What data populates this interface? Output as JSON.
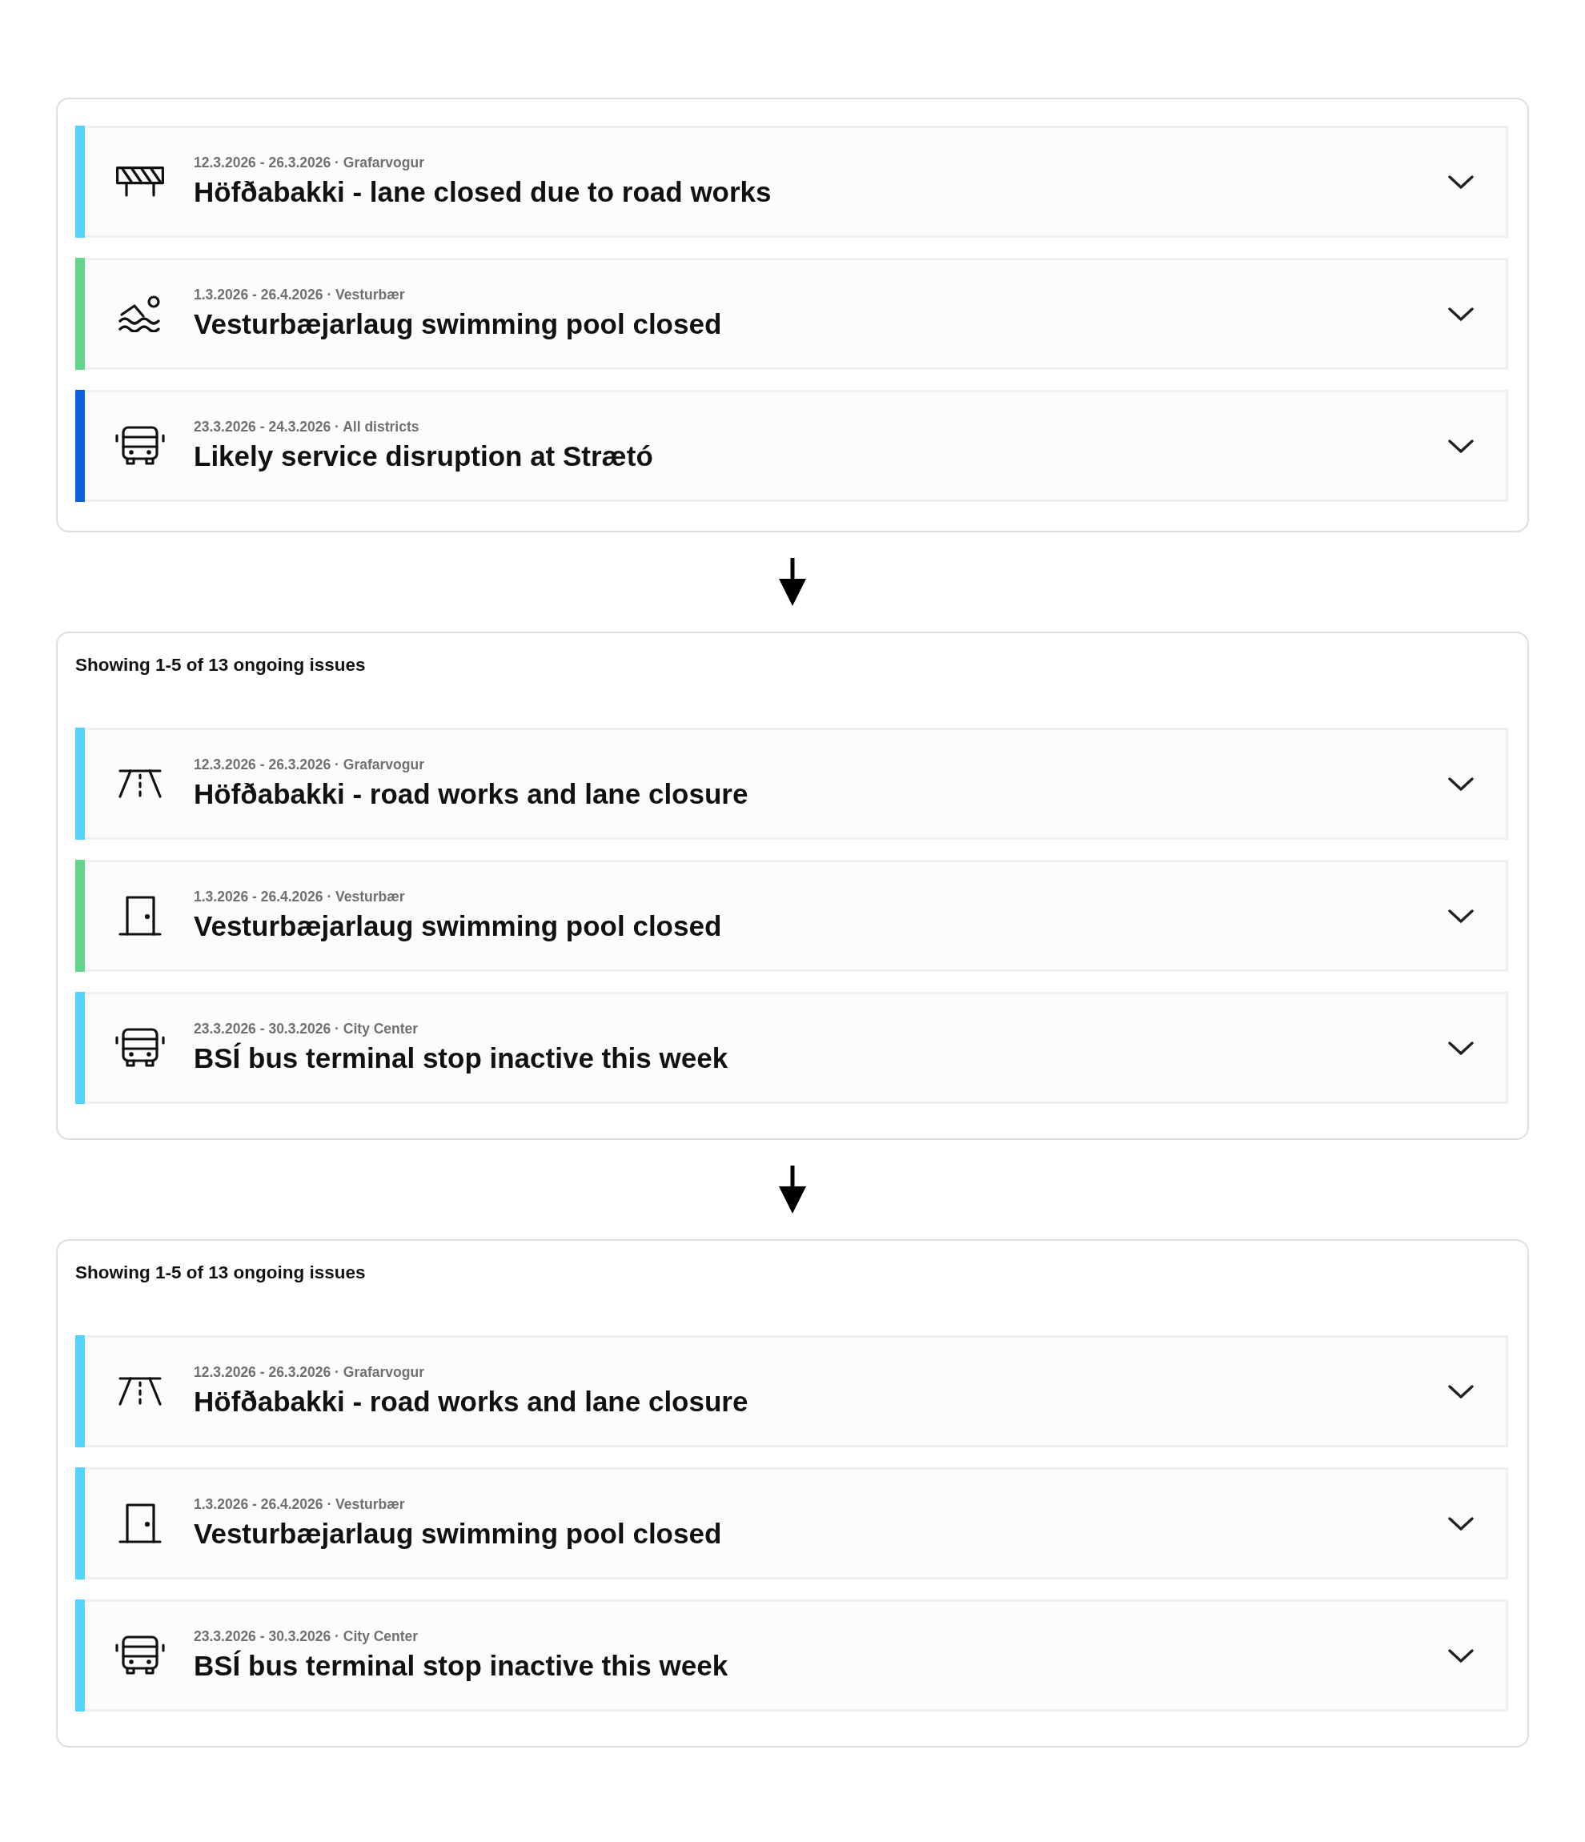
{
  "panels": [
    {
      "items": [
        {
          "kind": "barrier",
          "color": "#52d5fc",
          "meta": "12.3.2026 - 26.3.2026 · Grafarvogur",
          "title": "Höfðabakki - lane closed due to road works",
          "expanded": false
        },
        {
          "kind": "swimmer",
          "color": "#63d48c",
          "meta": "1.3.2026 - 26.4.2026 · Vesturbær",
          "title": "Vesturbæjarlaug swimming pool closed",
          "expanded": false
        },
        {
          "kind": "bus",
          "color": "#0b62de",
          "meta": "23.3.2026 - 24.3.2026 · All districts",
          "title": "Likely service disruption at Strætó",
          "expanded": false
        }
      ]
    },
    {
      "summary": "Showing 1-5 of 13 ongoing issues",
      "items": [
        {
          "kind": "road",
          "color": "#52d5fc",
          "meta": "12.3.2026 - 26.3.2026 · Grafarvogur",
          "title": "Höfðabakki - road works and lane closure",
          "expanded": false
        },
        {
          "kind": "door",
          "color": "#63d48c",
          "meta": "1.3.2026 - 26.4.2026 · Vesturbær",
          "title": "Vesturbæjarlaug swimming pool closed",
          "expanded": false
        },
        {
          "kind": "bus",
          "color": "#52d5fc",
          "meta": "23.3.2026 - 30.3.2026 · City Center",
          "title": "BSÍ bus terminal stop inactive this week",
          "expanded": false
        }
      ]
    },
    {
      "summary": "Showing 1-5 of 13 ongoing issues",
      "items": [
        {
          "kind": "road",
          "color": "#52d5fc",
          "meta": "12.3.2026 - 26.3.2026 · Grafarvogur",
          "title": "Höfðabakki - road works and lane closure",
          "expanded": false
        },
        {
          "kind": "door",
          "color": "#52d5fc",
          "meta": "1.3.2026 - 26.4.2026 · Vesturbær",
          "title": "Vesturbæjarlaug swimming pool closed",
          "expanded": false
        },
        {
          "kind": "bus",
          "color": "#52d5fc",
          "meta": "23.3.2026 - 30.3.2026 · City Center",
          "title": "BSÍ bus terminal stop inactive this week",
          "expanded": false
        }
      ]
    }
  ]
}
